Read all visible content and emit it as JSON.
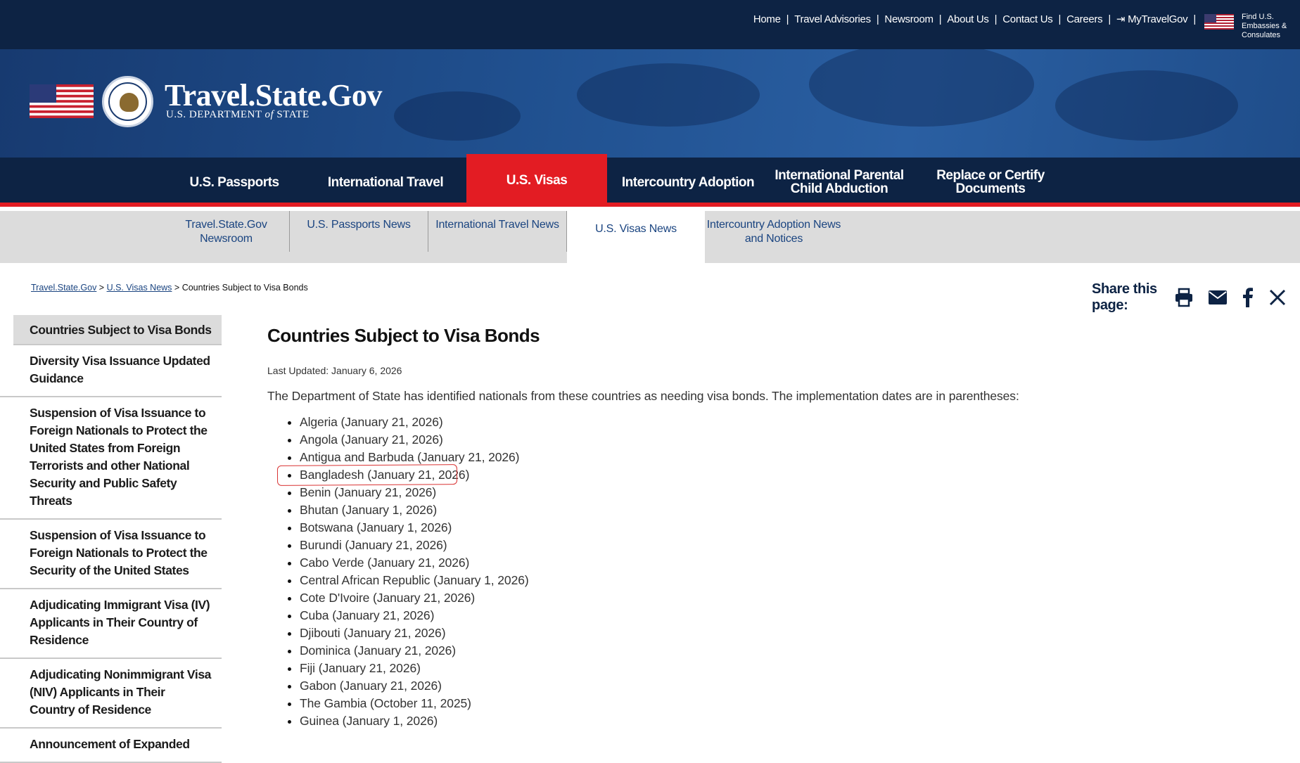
{
  "utility_nav": {
    "links": [
      "Home",
      "Travel Advisories",
      "Newsroom",
      "About Us",
      "Contact Us",
      "Careers",
      "MyTravelGov"
    ],
    "find_label": "Find U.S. Embassies & Consulates"
  },
  "banner": {
    "site_title": "Travel.State.Gov",
    "subtitle_pre": "U.S. DEPARTMENT ",
    "subtitle_of": "of",
    "subtitle_post": " STATE"
  },
  "main_nav": [
    {
      "label": "U.S. Passports"
    },
    {
      "label": "International Travel"
    },
    {
      "label": "U.S. Visas",
      "active": true
    },
    {
      "label": "Intercountry Adoption"
    },
    {
      "label": "International Parental Child Abduction"
    },
    {
      "label": "Replace or Certify Documents"
    }
  ],
  "sub_nav": [
    {
      "label": "Travel.State.Gov Newsroom"
    },
    {
      "label": "U.S. Passports News"
    },
    {
      "label": "International Travel News"
    },
    {
      "label": "U.S. Visas News",
      "active": true
    },
    {
      "label": "Intercountry Adoption News and Notices"
    }
  ],
  "breadcrumb": {
    "items": [
      "Travel.State.Gov",
      "U.S. Visas News"
    ],
    "current": "Countries Subject to Visa Bonds"
  },
  "share": {
    "label": "Share this page:",
    "icons": [
      "print-icon",
      "email-icon",
      "facebook-icon",
      "x-icon"
    ]
  },
  "sidebar": [
    "Countries Subject to Visa Bonds",
    "Diversity Visa Issuance Updated Guidance",
    "Suspension of Visa Issuance to Foreign Nationals to Protect the United States from Foreign Terrorists and other National Security and Public Safety Threats",
    "Suspension of Visa Issuance to Foreign Nationals to Protect the Security of the United States",
    "Adjudicating Immigrant Visa (IV) Applicants in Their Country of Residence",
    "Adjudicating Nonimmigrant Visa (NIV) Applicants in Their Country of Residence",
    "Announcement of Expanded"
  ],
  "content": {
    "title": "Countries Subject to Visa Bonds",
    "last_updated": "Last Updated: January 6, 2026",
    "intro": "The Department of State has identified nationals from these countries as needing visa bonds.  The implementation dates are in parentheses:",
    "countries": [
      "Algeria (January 21, 2026)",
      "Angola (January 21, 2026)",
      "Antigua and Barbuda (January 21, 2026)",
      "Bangladesh (January 21, 2026)",
      "Benin (January 21, 2026)",
      "Bhutan (January 1, 2026)",
      "Botswana (January 1, 2026)",
      "Burundi (January 21, 2026)",
      "Cabo Verde (January 21, 2026)",
      "Central African Republic (January 1, 2026)",
      "Cote D'Ivoire (January 21, 2026)",
      "Cuba (January 21, 2026)",
      "Djibouti (January 21, 2026)",
      "Dominica (January 21, 2026)",
      "Fiji (January 21, 2026)",
      "Gabon (January 21, 2026)",
      "The Gambia (October 11, 2025)",
      "Guinea (January 1, 2026)"
    ],
    "highlighted_index": 3
  },
  "colors": {
    "navy": "#0d2344",
    "accent_red": "#e31c23",
    "link_blue": "#1a4480",
    "subnav_bg": "#dcdcdc",
    "annotation_red": "#d93333"
  }
}
